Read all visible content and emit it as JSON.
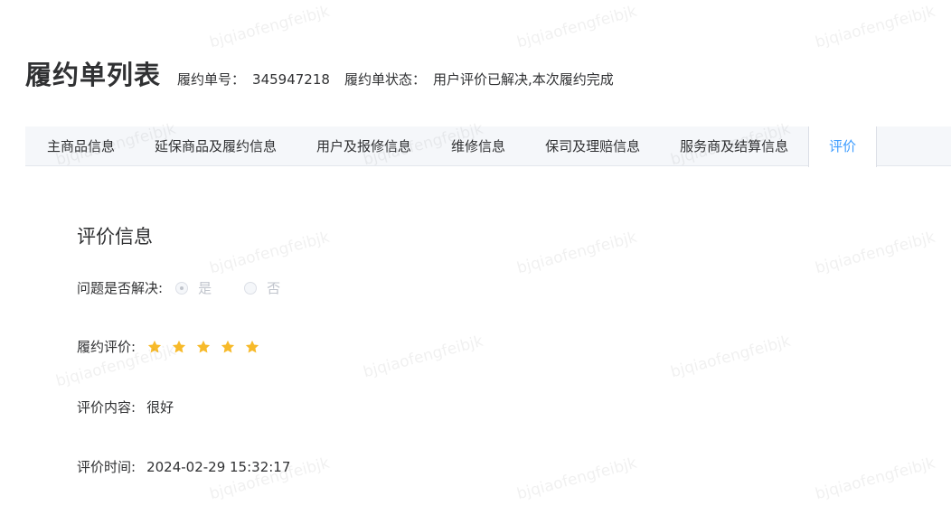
{
  "header": {
    "title": "履约单列表",
    "order_no_label": "履约单号：",
    "order_no_value": "345947218",
    "status_label": "履约单状态：",
    "status_value": "用户评价已解决,本次履约完成"
  },
  "tabs": [
    {
      "label": "主商品信息"
    },
    {
      "label": "延保商品及履约信息"
    },
    {
      "label": "用户及报修信息"
    },
    {
      "label": "维修信息"
    },
    {
      "label": "保司及理赔信息"
    },
    {
      "label": "服务商及结算信息"
    },
    {
      "label": "评价"
    }
  ],
  "active_tab_index": 6,
  "evaluation": {
    "section_title": "评价信息",
    "resolved_label": "问题是否解决:",
    "resolved_options": [
      {
        "label": "是",
        "checked": true
      },
      {
        "label": "否",
        "checked": false
      }
    ],
    "rating_label": "履约评价:",
    "rating_value": 5,
    "rating_max": 5,
    "content_label": "评价内容:",
    "content_value": "很好",
    "time_label": "评价时间:",
    "time_value": "2024-02-29 15:32:17"
  },
  "colors": {
    "accent": "#409eff",
    "star": "#f7ba2a",
    "disabled": "#c0c4cc"
  },
  "watermark_text": "bjqiaofengfeibjk"
}
